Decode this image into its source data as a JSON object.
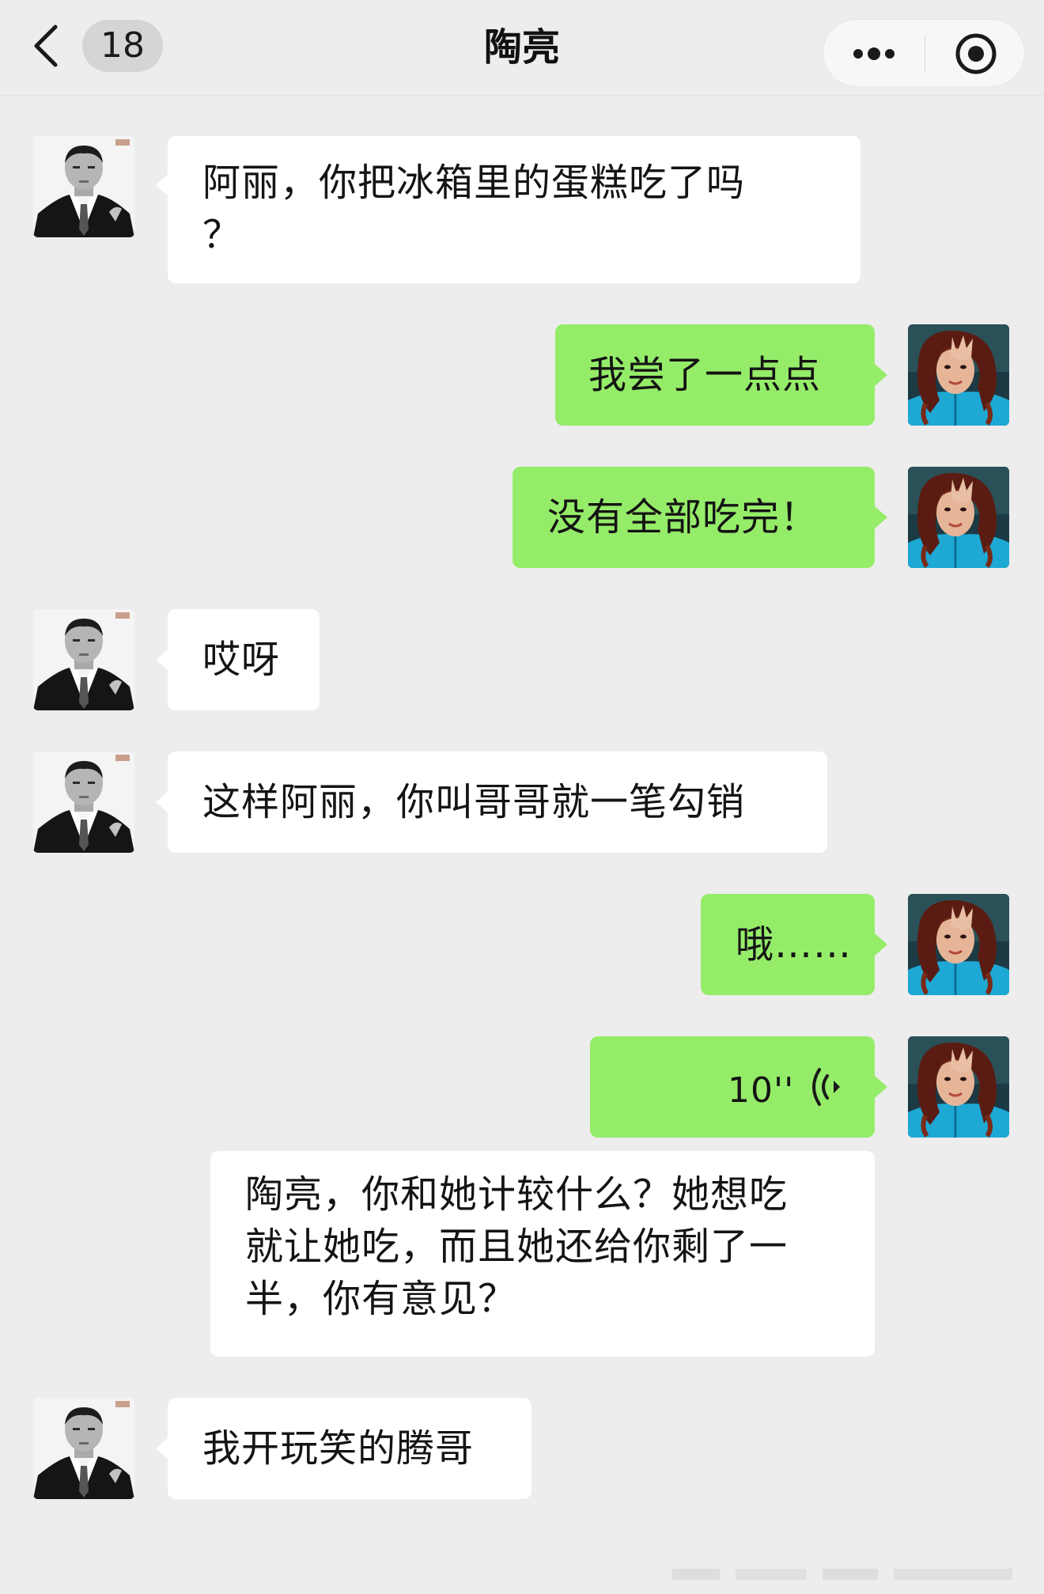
{
  "header": {
    "back_icon": "chevron-left-icon",
    "unread_count": "18",
    "title": "陶亮",
    "more_icon": "more-dots-icon",
    "close_icon": "target-circle-icon"
  },
  "colors": {
    "background": "#ededed",
    "incoming_bubble": "#ffffff",
    "outgoing_bubble": "#95ec69"
  },
  "messages": [
    {
      "side": "left",
      "sender": "陶亮",
      "type": "text",
      "lines": [
        "阿丽，你把冰箱里的蛋糕吃了吗",
        "？"
      ]
    },
    {
      "side": "right",
      "sender": "阿丽",
      "type": "text",
      "text": "我尝了一点点"
    },
    {
      "side": "right",
      "sender": "阿丽",
      "type": "text",
      "text": "没有全部吃完！"
    },
    {
      "side": "left",
      "sender": "陶亮",
      "type": "text",
      "text": "哎呀"
    },
    {
      "side": "left",
      "sender": "陶亮",
      "type": "text",
      "text": "这样阿丽，你叫哥哥就一笔勾销"
    },
    {
      "side": "right",
      "sender": "阿丽",
      "type": "text",
      "text": "哦……"
    },
    {
      "side": "right",
      "sender": "阿丽",
      "type": "voice",
      "duration": "10''",
      "icon": "voice-wave-icon"
    },
    {
      "side": "none",
      "type": "transcript",
      "lines": [
        "陶亮，你和她计较什么？她想吃",
        "就让她吃，而且她还给你剩了一",
        "半，你有意见？"
      ]
    },
    {
      "side": "left",
      "sender": "陶亮",
      "type": "text",
      "text": "我开玩笑的腾哥"
    }
  ]
}
